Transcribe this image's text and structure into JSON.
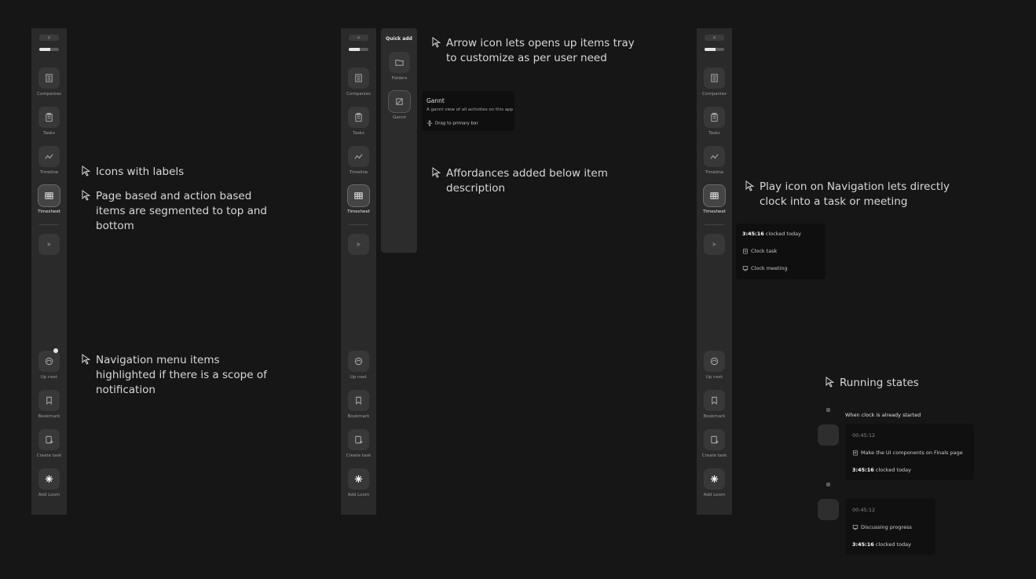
{
  "colors": {
    "background": "#161616",
    "sidebar": "#2a2a2a",
    "tooltip": "#0f0f0f"
  },
  "sidebar": {
    "expand_label": "»",
    "progress": 0.55,
    "top_items": [
      {
        "label": "Companies",
        "icon": "building-icon"
      },
      {
        "label": "Tasks",
        "icon": "clipboard-icon"
      },
      {
        "label": "Timeline",
        "icon": "trend-icon"
      },
      {
        "label": "Timesheet",
        "icon": "grid-icon",
        "active": true
      }
    ],
    "play_icon": "play-icon",
    "bottom_items": [
      {
        "label": "Up next",
        "icon": "gauge-icon"
      },
      {
        "label": "Bookmark",
        "icon": "bookmark-icon"
      },
      {
        "label": "Create task",
        "icon": "clipboard-plus-icon"
      },
      {
        "label": "Add Loom",
        "icon": "loom-icon"
      }
    ]
  },
  "quick_add": {
    "title": "Quick add",
    "items": [
      {
        "label": "Folders",
        "icon": "folder-icon"
      },
      {
        "label": "Gannt",
        "icon": "gantt-icon"
      }
    ]
  },
  "gantt_tooltip": {
    "title": "Gannt",
    "description": "A gannt view of all activities on this app",
    "action": "Drag to primary bar"
  },
  "annotations": {
    "icons_labels": "Icons with labels",
    "segmented": "Page based and action based items are segmented to top and bottom",
    "notification": "Navigation menu items highlighted if there is a scope of notification",
    "arrow": "Arrow icon lets opens up items tray to customize as per user need",
    "affordances": "Affordances added below item description",
    "play": "Play icon on Navigation lets directly clock into a task or meeting",
    "running": "Running states"
  },
  "clock_tooltip": {
    "clocked_value": "3:45:16",
    "clocked_suffix": " clocked today",
    "task": "Clock task",
    "meeting": "Clock meeting"
  },
  "running_states": {
    "heading": "When clock is already started",
    "card1": {
      "time": "00:45:12",
      "task": "Make the UI components on Finals page",
      "clocked_value": "3:45:16",
      "clocked_suffix": " clocked today"
    },
    "card2": {
      "time": "00:45:12",
      "task": "Discussing progress",
      "clocked_value": "3:45:16",
      "clocked_suffix": " clocked today"
    }
  }
}
